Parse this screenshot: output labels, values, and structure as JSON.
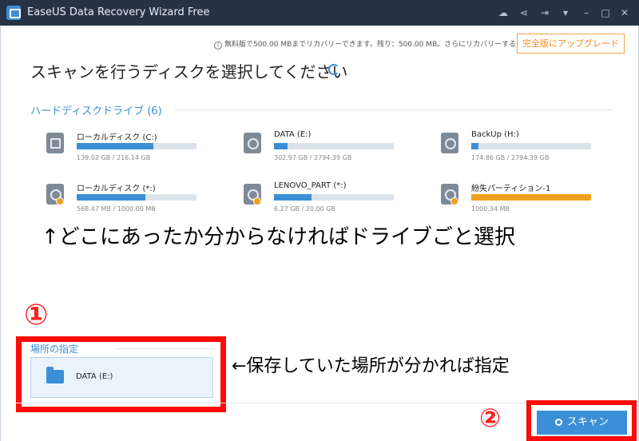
{
  "window": {
    "title": "EaseUS Data Recovery Wizard Free",
    "controls": [
      "upload-icon",
      "share-icon",
      "login-icon",
      "menu-icon",
      "minimize-icon",
      "maximize-icon",
      "close-icon"
    ]
  },
  "notice": {
    "text": "無料版で500.00 MBまでリカバリーできます。残り：500.00 MB。さらにリカバリーするには、",
    "upgrade_label": "完全版にアップグレード"
  },
  "page_title": "スキャンを行うディスクを選択してください",
  "hard_drives": {
    "title": "ハードディスクドライブ (6)",
    "items": [
      {
        "name": "ローカルディスク (C:)",
        "size": "139.02 GB / 216.14 GB",
        "used_fraction": 0.64,
        "icon": "windows-disk-icon",
        "color": "#3b8fd6"
      },
      {
        "name": "DATA (E:)",
        "size": "302.97 GB / 2794.39 GB",
        "used_fraction": 0.11,
        "icon": "disk-icon",
        "color": "#3b8fd6"
      },
      {
        "name": "BackUp (H:)",
        "size": "174.86 GB / 2794.39 GB",
        "used_fraction": 0.06,
        "icon": "disk-icon",
        "color": "#3b8fd6"
      },
      {
        "name": "ローカルディスク (*:)",
        "size": "568.47 MB / 1000.00 MB",
        "used_fraction": 0.57,
        "icon": "disk-warning-icon",
        "color": "#3b8fd6"
      },
      {
        "name": "LENOVO_PART (*:)",
        "size": "6.27 GB / 20.00 GB",
        "used_fraction": 0.31,
        "icon": "disk-warning-icon",
        "color": "#3b8fd6"
      },
      {
        "name": "紛失パーティション-1",
        "size": "1000.34 MB",
        "used_fraction": 1.0,
        "icon": "disk-warning-icon",
        "color": "#f0a020"
      }
    ]
  },
  "annotations": {
    "top": "↑どこにあったか分からなければドライブごと選択",
    "bottom": "←保存していた場所が分かれば指定",
    "marker1": "①",
    "marker2": "②"
  },
  "location": {
    "title": "場所の指定",
    "label": "DATA (E:)"
  },
  "scan": {
    "label": "スキャン"
  }
}
